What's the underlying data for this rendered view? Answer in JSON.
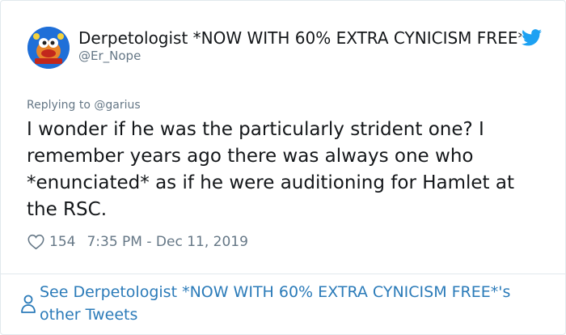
{
  "tweet": {
    "author_name": "Derpetologist *NOW WITH 60% EXTRA CYNICISM FREE*",
    "author_handle": "@Er_Nope",
    "reply_prefix": "Replying to ",
    "reply_to": "@garius",
    "text": "I wonder if he was the particularly strident one? I\nremember years ago there was always one who\n*enunciated* as if he were auditioning for Hamlet at\nthe RSC.",
    "like_count": "154",
    "timestamp": "7:35 PM - Dec 11, 2019"
  },
  "footer": {
    "link_text": "See Derpetologist *NOW WITH 60% EXTRA CYNICISM FREE*'s other Tweets"
  },
  "colors": {
    "link_blue": "#2b7bb9",
    "twitter_blue": "#1da1f2",
    "secondary_text": "#657786",
    "border": "#e1e8ed"
  },
  "icons": [
    "avatar-image",
    "twitter-bird-icon",
    "heart-icon",
    "person-icon"
  ]
}
